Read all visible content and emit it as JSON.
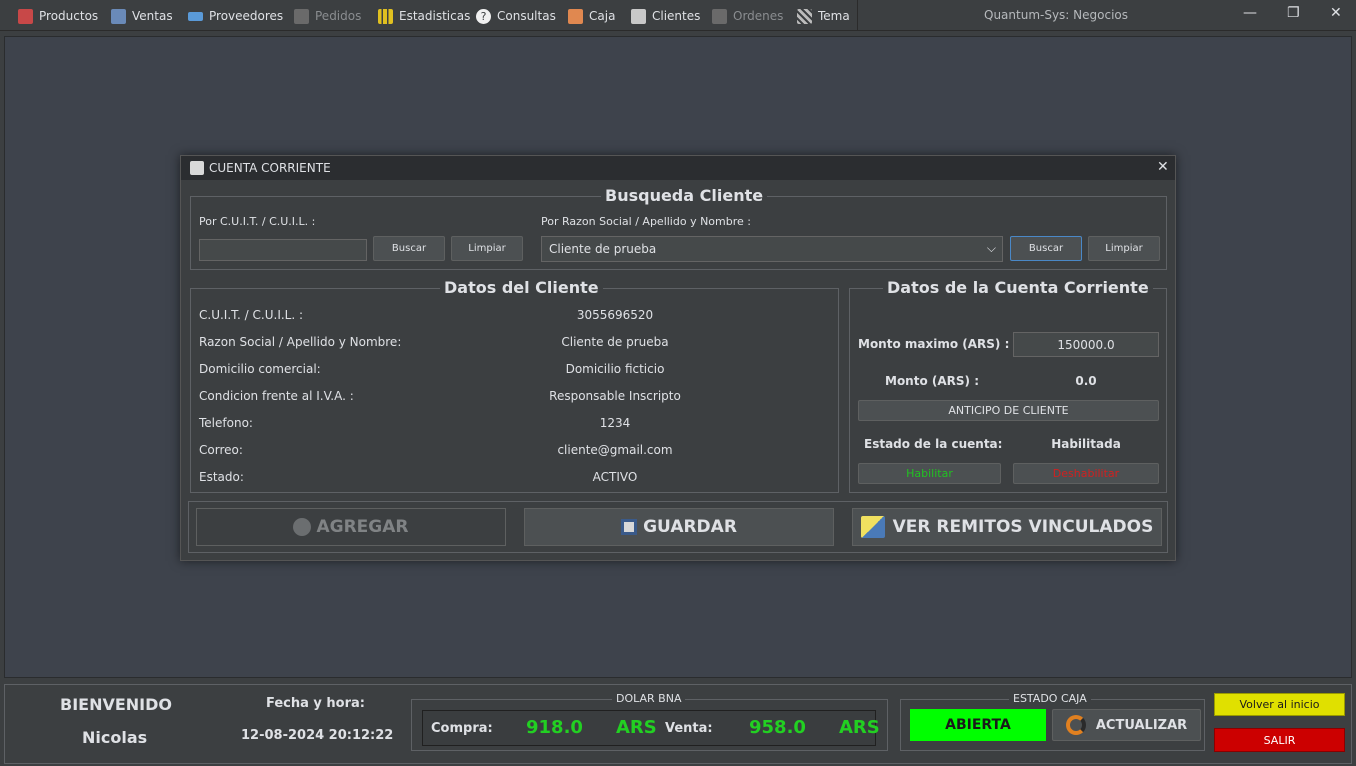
{
  "menu": {
    "items": [
      {
        "label": "Productos",
        "icon": "products-icon",
        "color": "#d04040",
        "enabled": true
      },
      {
        "label": "Ventas",
        "icon": "sales-icon",
        "color": "#6a8ab8",
        "enabled": true
      },
      {
        "label": "Proveedores",
        "icon": "suppliers-icon",
        "color": "#5a9ad8",
        "enabled": true
      },
      {
        "label": "Pedidos",
        "icon": "orders-icon",
        "color": "#888888",
        "enabled": false
      },
      {
        "label": "Estadisticas",
        "icon": "stats-icon",
        "color": "#e0c020",
        "enabled": true
      },
      {
        "label": "Consultas",
        "icon": "help-icon",
        "color": "#ffffff",
        "enabled": true
      },
      {
        "label": "Caja",
        "icon": "cashbox-icon",
        "color": "#e07840",
        "enabled": true
      },
      {
        "label": "Clientes",
        "icon": "clients-icon",
        "color": "#c0c0c0",
        "enabled": true
      },
      {
        "label": "Ordenes",
        "icon": "ordenes-icon",
        "color": "#888888",
        "enabled": false
      },
      {
        "label": "Tema",
        "icon": "theme-icon",
        "color": "#aaaaaa",
        "enabled": true
      }
    ]
  },
  "window": {
    "title": "Quantum-Sys: Negocios",
    "minimize": "—",
    "restore": "❐",
    "close": "✕"
  },
  "dialog": {
    "title": "CUENTA CORRIENTE",
    "close": "✕",
    "search": {
      "group_title": "Busqueda Cliente",
      "cuit_label": "Por C.U.I.T. / C.U.I.L. :",
      "cuit_value": "",
      "search_button": "Buscar",
      "clear_button": "Limpiar",
      "name_label": "Por Razon Social / Apellido y Nombre :",
      "name_selected": "Cliente de prueba",
      "search_button2": "Buscar",
      "clear_button2": "Limpiar"
    },
    "client": {
      "group_title": "Datos del Cliente",
      "rows": [
        {
          "label": "C.U.I.T. / C.U.I.L. :",
          "value": "3055696520"
        },
        {
          "label": "Razon Social / Apellido y Nombre:",
          "value": "Cliente de prueba"
        },
        {
          "label": "Domicilio comercial:",
          "value": "Domicilio ficticio"
        },
        {
          "label": "Condicion frente al I.V.A. :",
          "value": "Responsable Inscripto"
        },
        {
          "label": "Telefono:",
          "value": "1234"
        },
        {
          "label": "Correo:",
          "value": "cliente@gmail.com"
        },
        {
          "label": "Estado:",
          "value": "ACTIVO"
        }
      ]
    },
    "account": {
      "group_title": "Datos de la Cuenta Corriente",
      "max_label": "Monto maximo (ARS) :",
      "max_value": "150000.0",
      "amount_label": "Monto (ARS) :",
      "amount_value": "0.0",
      "advance_button": "ANTICIPO DE CLIENTE",
      "state_label": "Estado de la cuenta:",
      "state_value": "Habilitada",
      "enable_button": "Habilitar",
      "disable_button": "Deshabilitar",
      "enable_color": "#22c022",
      "disable_color": "#d02020"
    },
    "actions": {
      "add": "AGREGAR",
      "save": "GUARDAR",
      "remitos": "VER REMITOS VINCULADOS"
    }
  },
  "bottom": {
    "welcome": "BIENVENIDO",
    "user": "Nicolas",
    "datetime_label": "Fecha y hora:",
    "datetime": "12-08-2024 20:12:22",
    "dollar": {
      "title": "DOLAR BNA",
      "buy_label": "Compra:",
      "buy_value": "918.0",
      "buy_currency": "ARS",
      "sell_label": "Venta:",
      "sell_value": "958.0",
      "sell_currency": "ARS"
    },
    "cash": {
      "title": "ESTADO CAJA",
      "state": "ABIERTA",
      "refresh": "ACTUALIZAR"
    },
    "home_button": "Volver al inicio",
    "exit_button": "SALIR",
    "colors": {
      "open": "#00ff00",
      "home": "#e0e000",
      "exit": "#cc0000"
    }
  }
}
